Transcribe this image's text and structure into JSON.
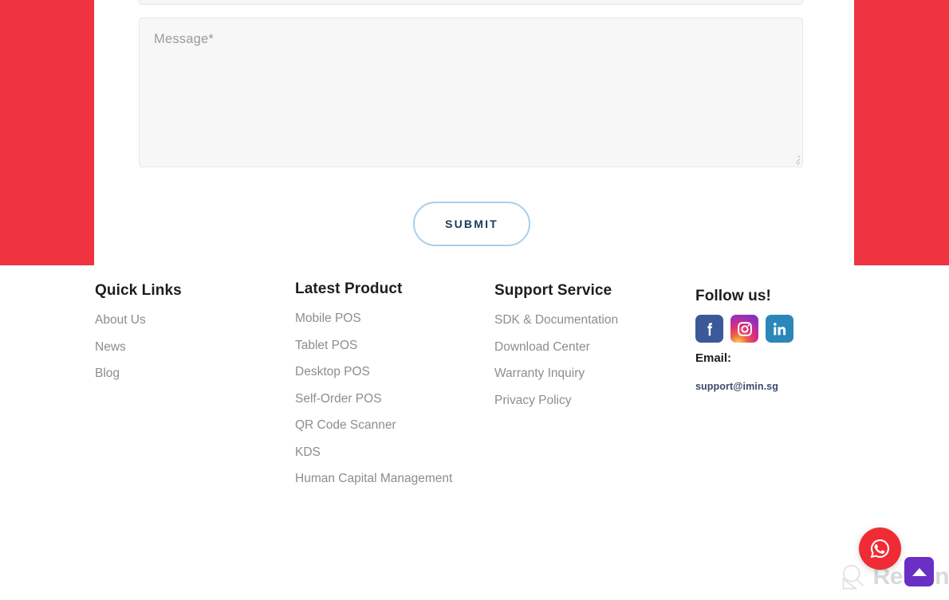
{
  "page": {
    "accent_red": "#ef3340",
    "background": "#ffffff"
  },
  "contact_form": {
    "top_field_placeholder": "",
    "message_placeholder": "Message*",
    "submit_label": "SUBMIT",
    "submit_border_color": "#a9cfe4",
    "submit_text_color": "#193a5a",
    "resize_handle_name": "textarea-resize-handle"
  },
  "footer": {
    "columns": [
      {
        "id": "quick-links",
        "heading": "Quick Links",
        "links": [
          "About Us",
          "News",
          "Blog"
        ]
      },
      {
        "id": "latest-product",
        "heading": "Latest Product",
        "links": [
          "Mobile POS",
          "Tablet POS",
          "Desktop POS",
          "Self-Order POS",
          "QR Code Scanner",
          "KDS",
          "Human Capital Management"
        ]
      },
      {
        "id": "support-service",
        "heading": "Support Service",
        "links": [
          "SDK & Documentation",
          "Download Center",
          "Warranty Inquiry",
          "Privacy Policy"
        ]
      }
    ],
    "follow": {
      "heading": "Follow us!",
      "socials": [
        {
          "name": "facebook-icon",
          "color": "#3b5998"
        },
        {
          "name": "instagram-icon",
          "color": "#d92e7f"
        },
        {
          "name": "linkedin-icon",
          "color": "#2a87b8"
        }
      ],
      "email_label": "Email:",
      "email_address": "support@imin.sg",
      "email_color": "#3b4a6b"
    }
  },
  "widgets": {
    "whatsapp": {
      "name": "whatsapp-icon",
      "color": "#f02b35"
    },
    "scroll_top": {
      "name": "scroll-to-top-button",
      "color": "#6a2fc4"
    }
  },
  "watermark": {
    "text": "Revain",
    "color": "#d9d9dd"
  }
}
